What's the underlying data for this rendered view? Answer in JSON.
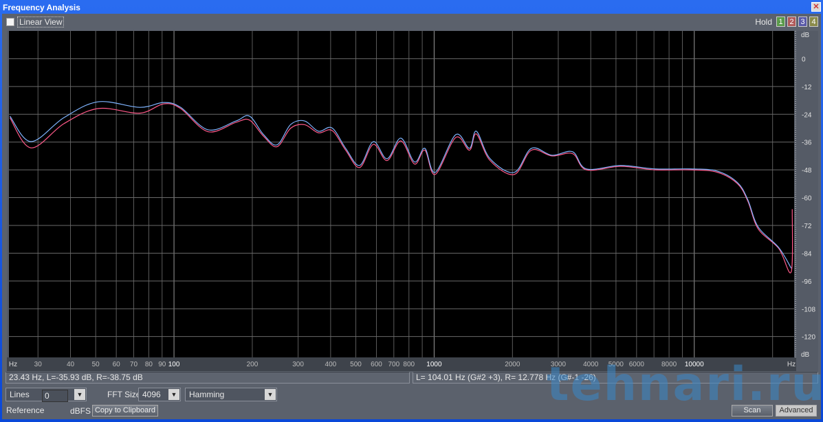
{
  "window": {
    "title": "Frequency Analysis",
    "close_icon": "close-icon"
  },
  "toolbar": {
    "linear_view": "Linear View",
    "linear_view_checked": false,
    "hold_label": "Hold",
    "hold_buttons": [
      {
        "label": "1",
        "color": "#5a9a4a"
      },
      {
        "label": "2",
        "color": "#b05a5a"
      },
      {
        "label": "3",
        "color": "#5a5aa8"
      },
      {
        "label": "4",
        "color": "#8a8a4a"
      }
    ]
  },
  "status": {
    "left": "23.43 Hz, L=-35.93 dB, R=-38.75 dB",
    "right": "L= 104.01 Hz (G#2 +3), R= 12.778 Hz (G#-1 -26)"
  },
  "controls": {
    "display_mode": "Lines",
    "fft_label": "FFT Size",
    "fft_size": "4096",
    "window_fn": "Hamming",
    "reference_label": "Reference",
    "reference_value": "0",
    "reference_unit": "dBFS",
    "copy_button": "Copy to Clipboard",
    "scan_button": "Scan",
    "advanced_button": "Advanced"
  },
  "watermark": "tehnari.ru",
  "chart_data": {
    "type": "line",
    "xscale": "log",
    "xlim": [
      23.2,
      24200
    ],
    "ylim": [
      -129,
      12
    ],
    "xlabel": "Hz",
    "ylabel": "dB",
    "grid": true,
    "x_ticks": [
      30,
      40,
      50,
      60,
      70,
      80,
      90,
      100,
      200,
      300,
      400,
      500,
      600,
      700,
      800,
      900,
      1000,
      2000,
      3000,
      4000,
      5000,
      6000,
      7000,
      8000,
      9000,
      10000,
      20000
    ],
    "x_tick_labels": [
      "30",
      "40",
      "50",
      "60",
      "70",
      "80",
      "90",
      "100",
      "200",
      "300",
      "400",
      "500",
      "600",
      "700",
      "800",
      "1000",
      "2000",
      "3000",
      "4000",
      "5000",
      "6000",
      "8000",
      "10000"
    ],
    "x_tick_label_values": [
      30,
      40,
      50,
      60,
      70,
      80,
      90,
      100,
      200,
      300,
      400,
      500,
      600,
      700,
      800,
      1000,
      2000,
      3000,
      4000,
      5000,
      6000,
      8000,
      10000
    ],
    "y_ticks": [
      0,
      -12,
      -24,
      -36,
      -48,
      -60,
      -72,
      -84,
      -96,
      -108,
      -120
    ],
    "series": [
      {
        "channel": "L",
        "color": "#7fb4ff",
        "points": [
          [
            23.4,
            -24.8
          ],
          [
            28.2,
            -35.8
          ],
          [
            37.8,
            -25.4
          ],
          [
            51.2,
            -18.6
          ],
          [
            73.8,
            -21
          ],
          [
            91.3,
            -18.9
          ],
          [
            106,
            -21
          ],
          [
            135,
            -30.7
          ],
          [
            173,
            -26.9
          ],
          [
            195,
            -24.8
          ],
          [
            221,
            -32.8
          ],
          [
            249,
            -37.2
          ],
          [
            281,
            -28.4
          ],
          [
            318,
            -26.9
          ],
          [
            359,
            -31.3
          ],
          [
            405,
            -29.9
          ],
          [
            457,
            -38.7
          ],
          [
            517,
            -46.1
          ],
          [
            584,
            -35.8
          ],
          [
            659,
            -43.2
          ],
          [
            745,
            -34.3
          ],
          [
            841,
            -44.6
          ],
          [
            921,
            -38.7
          ],
          [
            1009,
            -49.1
          ],
          [
            1211,
            -32.8
          ],
          [
            1367,
            -38.7
          ],
          [
            1453,
            -31.3
          ],
          [
            1641,
            -43.2
          ],
          [
            2031,
            -49.1
          ],
          [
            2366,
            -38.7
          ],
          [
            2838,
            -41.7
          ],
          [
            3406,
            -40.2
          ],
          [
            3846,
            -47.6
          ],
          [
            5212,
            -46.1
          ],
          [
            7063,
            -47.6
          ],
          [
            9590,
            -47.6
          ],
          [
            12220,
            -48.5
          ],
          [
            14660,
            -53.5
          ],
          [
            16060,
            -60.9
          ],
          [
            17610,
            -72.7
          ],
          [
            21130,
            -81.6
          ],
          [
            23590,
            -90.5
          ]
        ]
      },
      {
        "channel": "R",
        "color": "#ff5a8a",
        "points": [
          [
            23.4,
            -25.5
          ],
          [
            28.2,
            -38.5
          ],
          [
            37.8,
            -28
          ],
          [
            51.2,
            -21.5
          ],
          [
            73.8,
            -23.5
          ],
          [
            91.3,
            -19.5
          ],
          [
            106,
            -21.5
          ],
          [
            135,
            -31.5
          ],
          [
            173,
            -27.5
          ],
          [
            195,
            -26.5
          ],
          [
            221,
            -33.5
          ],
          [
            249,
            -38
          ],
          [
            281,
            -30
          ],
          [
            318,
            -28.5
          ],
          [
            359,
            -32
          ],
          [
            405,
            -31
          ],
          [
            457,
            -39.5
          ],
          [
            517,
            -47
          ],
          [
            584,
            -37
          ],
          [
            659,
            -44
          ],
          [
            745,
            -35.5
          ],
          [
            841,
            -45.5
          ],
          [
            921,
            -39.5
          ],
          [
            1009,
            -50
          ],
          [
            1211,
            -34
          ],
          [
            1367,
            -39.5
          ],
          [
            1453,
            -32.5
          ],
          [
            1641,
            -44
          ],
          [
            2031,
            -50
          ],
          [
            2366,
            -39.5
          ],
          [
            2838,
            -42
          ],
          [
            3406,
            -41
          ],
          [
            3846,
            -48
          ],
          [
            5212,
            -46.5
          ],
          [
            7063,
            -48
          ],
          [
            9590,
            -48
          ],
          [
            12220,
            -49
          ],
          [
            14660,
            -54
          ],
          [
            16060,
            -61.5
          ],
          [
            17610,
            -73.5
          ],
          [
            21130,
            -82
          ],
          [
            23590,
            -92
          ],
          [
            23800,
            -65
          ]
        ]
      }
    ]
  }
}
